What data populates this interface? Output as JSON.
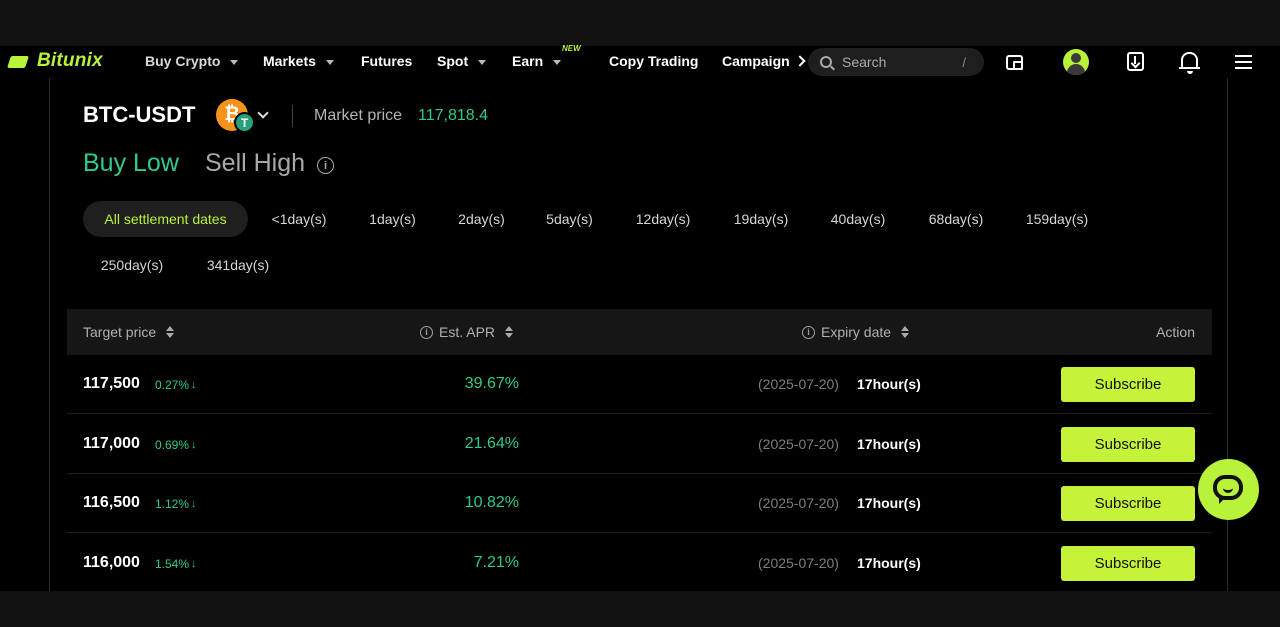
{
  "nav": {
    "logo": "Bitunix",
    "items": [
      {
        "label": "Buy Crypto"
      },
      {
        "label": "Markets"
      },
      {
        "label": "Futures"
      },
      {
        "label": "Spot"
      },
      {
        "label": "Earn",
        "badge": "NEW"
      },
      {
        "label": "Copy Trading"
      },
      {
        "label": "Campaign"
      }
    ],
    "search_placeholder": "Search",
    "search_shortcut": "/"
  },
  "header": {
    "pair": "BTC-USDT",
    "base_coin_glyph": "₿",
    "quote_coin_glyph": "T",
    "market_price_label": "Market price",
    "market_price_value": "117,818.4"
  },
  "mode_tabs": {
    "buy": "Buy Low",
    "sell": "Sell High"
  },
  "settlement_filters": [
    "All settlement dates",
    "<1day(s)",
    "1day(s)",
    "2day(s)",
    "5day(s)",
    "12day(s)",
    "19day(s)",
    "40day(s)",
    "68day(s)",
    "159day(s)",
    "250day(s)",
    "341day(s)"
  ],
  "table": {
    "headers": {
      "target": "Target price",
      "apr": "Est. APR",
      "expiry": "Expiry date",
      "action": "Action"
    },
    "rows": [
      {
        "price": "117,500",
        "pct": "0.27%",
        "apr": "39.67%",
        "date": "(2025-07-20)",
        "hours": "17hour(s)",
        "action": "Subscribe"
      },
      {
        "price": "117,000",
        "pct": "0.69%",
        "apr": "21.64%",
        "date": "(2025-07-20)",
        "hours": "17hour(s)",
        "action": "Subscribe"
      },
      {
        "price": "116,500",
        "pct": "1.12%",
        "apr": "10.82%",
        "date": "(2025-07-20)",
        "hours": "17hour(s)",
        "action": "Subscribe"
      },
      {
        "price": "116,000",
        "pct": "1.54%",
        "apr": "7.21%",
        "date": "(2025-07-20)",
        "hours": "17hour(s)",
        "action": "Subscribe"
      }
    ]
  },
  "colors": {
    "accent": "#b8f33a",
    "positive": "#2ecb8b",
    "background": "#000000"
  }
}
